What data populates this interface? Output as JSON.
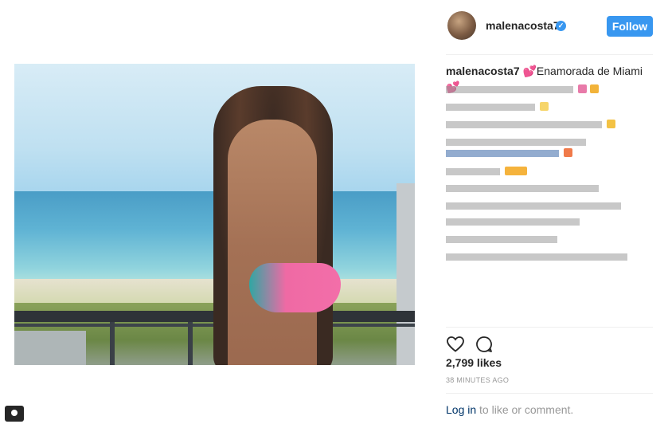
{
  "post": {
    "username": "malenacosta7",
    "verified_glyph": "✓",
    "follow_label": "Follow",
    "caption_user": "malenacosta7",
    "caption_text": "💕Enamorada de Miami 💕",
    "likes": "2,799 likes",
    "time": "38 MINUTES AGO",
    "login_link": "Log in",
    "login_rest": " to like or comment."
  },
  "icons": {
    "heart": "heart-icon",
    "comment": "comment-icon",
    "share": "share-icon",
    "verified": "verified-badge-icon"
  },
  "colors": {
    "accent": "#3897f0",
    "text": "#262626",
    "muted": "#999999",
    "link": "#003569"
  }
}
